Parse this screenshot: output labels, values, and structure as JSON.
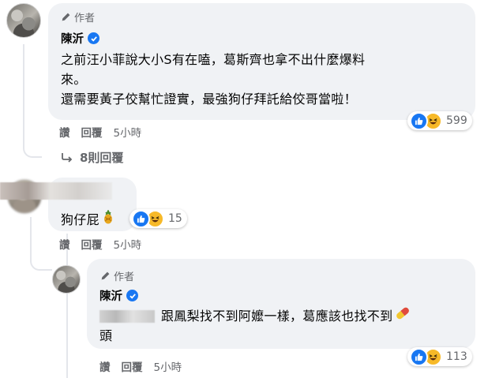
{
  "comment1": {
    "author_tag": "作者",
    "author_name": "陳沂",
    "text_line1": "之前汪小菲說大小S有在嗑，葛斯齊也拿不出什麼爆料",
    "text_line2": "來。",
    "text_line3": "還需要黃子佼幫忙證實，最強狗仔拜託給佼哥當啦！",
    "like_label": "讚",
    "reply_label": "回覆",
    "time": "5小時",
    "reactions": [
      "like-icon",
      "haha-icon"
    ],
    "reaction_count": "599",
    "replies_link": "8則回覆"
  },
  "comment2": {
    "text": "狗仔屁",
    "emoji": "pineapple-icon",
    "reactions": [
      "like-icon",
      "haha-icon"
    ],
    "reaction_count": "15",
    "like_label": "讚",
    "reply_label": "回覆",
    "time": "5小時"
  },
  "reply1": {
    "author_tag": "作者",
    "author_name": "陳沂",
    "text_part1": "跟鳳梨找不到阿嬤一樣，葛應該也找不到",
    "text_emoji": "pill-icon",
    "text_part2": "頭",
    "reactions": [
      "like-icon",
      "haha-icon"
    ],
    "reaction_count": "113",
    "like_label": "讚",
    "reply_label": "回覆",
    "time": "5小時"
  },
  "colors": {
    "bubble": "#f0f2f5",
    "secondary_text": "#65676b",
    "like_blue": "#1877f2",
    "haha_yellow": "#f7b928"
  }
}
